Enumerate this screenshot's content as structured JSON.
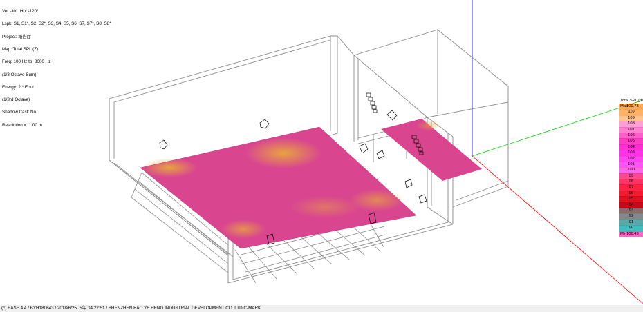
{
  "info_lines": [
    "Ver.-30°  Hor.-120°",
    "Lspk: S1, S1*, S2, S2*, S3, S4, S5, S6, S7, S7*, S8, S8*",
    "Project: 報告厅",
    "Map: Total SPL (Z)",
    "Freq: 100 Hz to  8000 Hz",
    "(1/3 Octave Sum)",
    "Energy: 2 * Eoot",
    "(1/3rd Octave)",
    "Shadow Cast: No",
    "Resolution =  1.00 m"
  ],
  "legend": {
    "title": "Total SPL [dB]",
    "max_label": "Max",
    "max_value": "109.73",
    "min_label": "Min",
    "min_value": "106.49",
    "levels": [
      {
        "value": "110",
        "color": "#ffb266"
      },
      {
        "value": "109",
        "color": "#ffc58a"
      },
      {
        "value": "108",
        "color": "#ff9fd6"
      },
      {
        "value": "107",
        "color": "#ff7fd0"
      },
      {
        "value": "106",
        "color": "#ff5ec8"
      },
      {
        "value": "105",
        "color": "#ff3dc4"
      },
      {
        "value": "104",
        "color": "#ff2fd2"
      },
      {
        "value": "103",
        "color": "#ff33e6"
      },
      {
        "value": "102",
        "color": "#ff44f0"
      },
      {
        "value": "101",
        "color": "#ff55f5"
      },
      {
        "value": "100",
        "color": "#ff66e6"
      },
      {
        "value": "99",
        "color": "#ff4a8a"
      },
      {
        "value": "98",
        "color": "#ff3366"
      },
      {
        "value": "97",
        "color": "#ff2244"
      },
      {
        "value": "96",
        "color": "#f21a2e"
      },
      {
        "value": "95",
        "color": "#e01020"
      },
      {
        "value": "94",
        "color": "#c80818"
      },
      {
        "value": "93",
        "color": "#8a6a6a"
      },
      {
        "value": "92",
        "color": "#7f8a8a"
      },
      {
        "value": "91",
        "color": "#5aa8a8"
      },
      {
        "value": "90",
        "color": "#3fbcbc"
      }
    ],
    "max_color": "#ffaa55",
    "min_color": "#ff66c8"
  },
  "footer": "(c) EASE 4.4  / BYH180643  / 2018/6/25 下午 04:22:51 / SHENZHEN BAO YE HENG INDUSTRIAL DEVELOPMENT CO.,LTD C-MARK",
  "colors": {
    "map_base": "#d9468f",
    "map_hot": "#e8a040",
    "wire": "#888888",
    "axis_x": "#ff0000",
    "axis_y": "#00dd00",
    "axis_z": "#0000ff"
  }
}
